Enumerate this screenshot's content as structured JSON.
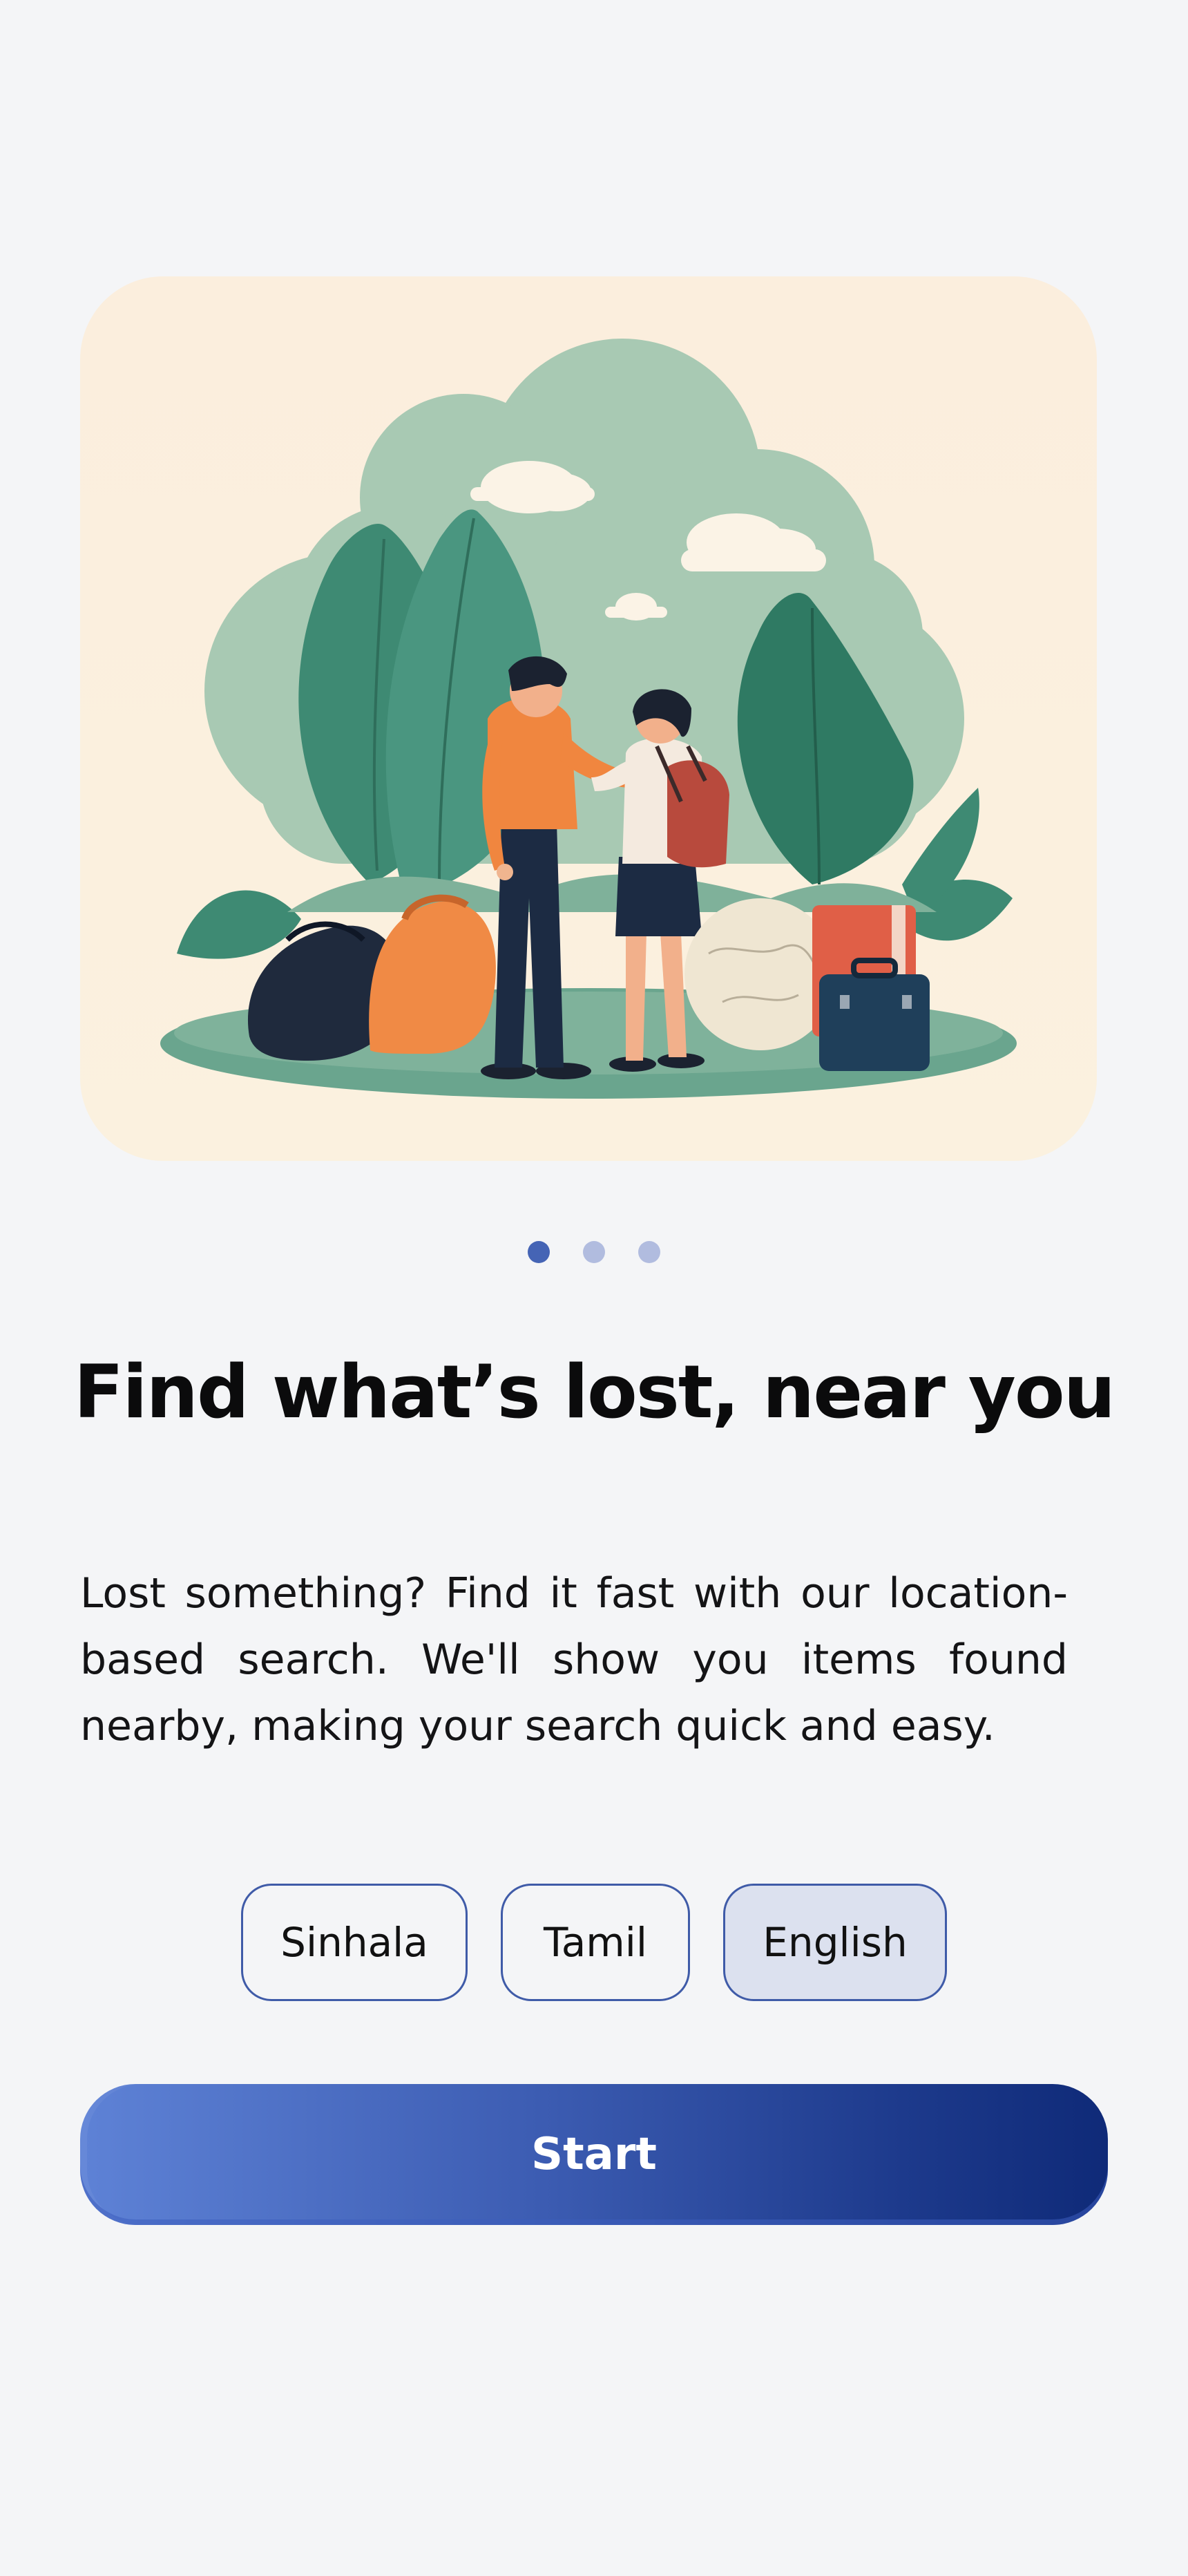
{
  "onboarding": {
    "illustration_icon": "people-exchanging-lost-item-illustration",
    "pager": {
      "total": 3,
      "active_index": 0
    },
    "title": "Find what’s lost, near you",
    "description": "Lost something? Find it fast with our location-based search. We'll show you items found nearby, making your search quick and easy.",
    "languages": [
      {
        "label": "Sinhala",
        "selected": false
      },
      {
        "label": "Tamil",
        "selected": false
      },
      {
        "label": "English",
        "selected": true
      }
    ],
    "start_label": "Start"
  },
  "colors": {
    "background": "#f4f5f7",
    "accent": "#3f5ba8",
    "pager_active": "#4564b5",
    "pager_inactive": "#b1bcdf",
    "selected_chip": "#dce1ef",
    "hero_bg": "#fbf1df",
    "foliage": "#3e8a73"
  }
}
